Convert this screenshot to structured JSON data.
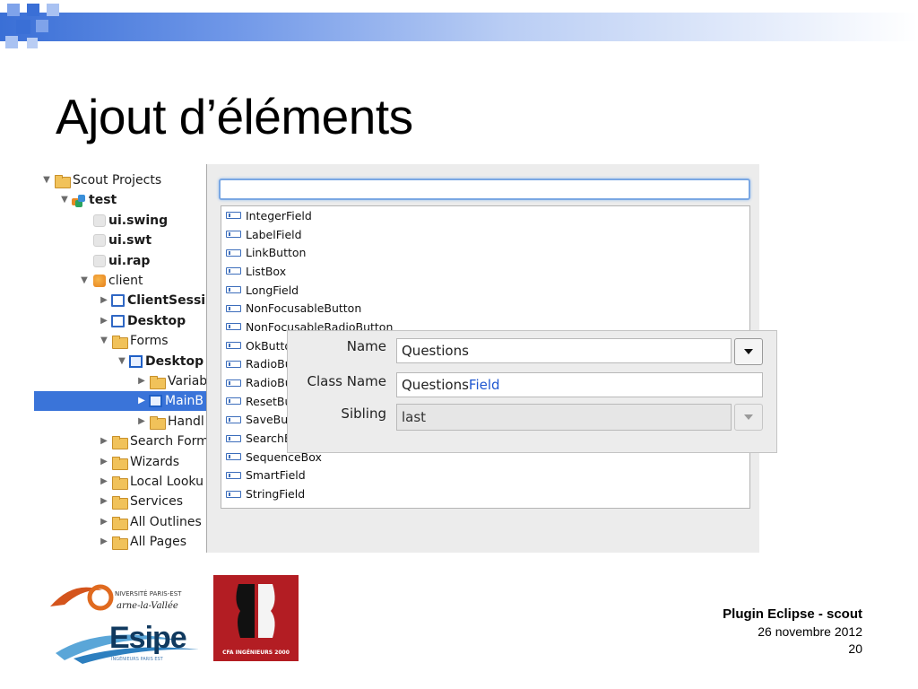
{
  "slide": {
    "title": "Ajout d’éléments"
  },
  "tree": {
    "items": [
      {
        "label": "Scout Projects",
        "bold": false,
        "icon": "folder-open-icon",
        "twisty": "▼",
        "level": 0
      },
      {
        "label": "test",
        "bold": true,
        "icon": "project-icon",
        "twisty": "▼",
        "level": 1
      },
      {
        "label": "ui.swing",
        "bold": true,
        "icon": "grey-cube-icon",
        "twisty": "",
        "level": 2
      },
      {
        "label": "ui.swt",
        "bold": true,
        "icon": "grey-cube-icon",
        "twisty": "",
        "level": 2
      },
      {
        "label": "ui.rap",
        "bold": true,
        "icon": "grey-cube-icon",
        "twisty": "",
        "level": 2
      },
      {
        "label": "client",
        "bold": false,
        "icon": "orange-cube-icon",
        "twisty": "▼",
        "level": 2
      },
      {
        "label": "ClientSessi",
        "bold": true,
        "icon": "window-icon",
        "twisty": "▶",
        "level": 3
      },
      {
        "label": "Desktop",
        "bold": true,
        "icon": "window-icon",
        "twisty": "▶",
        "level": 3
      },
      {
        "label": "Forms",
        "bold": false,
        "icon": "folder-open-icon",
        "twisty": "▼",
        "level": 3
      },
      {
        "label": "Desktop",
        "bold": true,
        "icon": "form-icon",
        "twisty": "▼",
        "level": 4
      },
      {
        "label": "Variab",
        "bold": false,
        "icon": "folder-icon",
        "twisty": "▶",
        "level": 5
      },
      {
        "label": "MainB",
        "bold": false,
        "icon": "box-icon",
        "twisty": "▶",
        "level": 5,
        "selected": true
      },
      {
        "label": "Handl",
        "bold": false,
        "icon": "folder-icon",
        "twisty": "▶",
        "level": 5
      },
      {
        "label": "Search Form",
        "bold": false,
        "icon": "folder-icon",
        "twisty": "▶",
        "level": 3
      },
      {
        "label": "Wizards",
        "bold": false,
        "icon": "folder-icon",
        "twisty": "▶",
        "level": 3
      },
      {
        "label": "Local Looku",
        "bold": false,
        "icon": "folder-icon",
        "twisty": "▶",
        "level": 3
      },
      {
        "label": "Services",
        "bold": false,
        "icon": "folder-icon",
        "twisty": "▶",
        "level": 3
      },
      {
        "label": "All Outlines",
        "bold": false,
        "icon": "folder-icon",
        "twisty": "▶",
        "level": 3
      },
      {
        "label": "All Pages",
        "bold": false,
        "icon": "folder-icon",
        "twisty": "▶",
        "level": 3
      }
    ]
  },
  "dialog": {
    "search_value": "",
    "list_items": [
      "IntegerField",
      "LabelField",
      "LinkButton",
      "ListBox",
      "LongField",
      "NonFocusableButton",
      "NonFocusableRadioButton",
      "OkButto",
      "RadioBu",
      "RadioBu",
      "ResetBu",
      "SaveBut",
      "SearchB",
      "SequenceBox",
      "SmartField",
      "StringField"
    ]
  },
  "form": {
    "name_label": "Name",
    "name_value": "Questions",
    "classname_label": "Class Name",
    "classname_prefix": "Questions",
    "classname_suffix": "Field",
    "sibling_label": "Sibling",
    "sibling_value": "last"
  },
  "footer": {
    "title": "Plugin Eclipse - scout",
    "date": "26 novembre 2012",
    "page": "20"
  },
  "logos": {
    "upem_line1": "NIVERSITÉ PARIS-EST",
    "upem_line2": "arne-la-Vallée",
    "esipe": "Esipe",
    "esipe_sub": "INGÉNIEURS PARIS EST",
    "cfa": "CFA INGÉNIEURS 2000"
  },
  "colors": {
    "selection": "#3a74d9",
    "accent_text": "#1e56d0",
    "header_gradient_start": "#3a6fd6",
    "cfa_red": "#b31d23"
  }
}
